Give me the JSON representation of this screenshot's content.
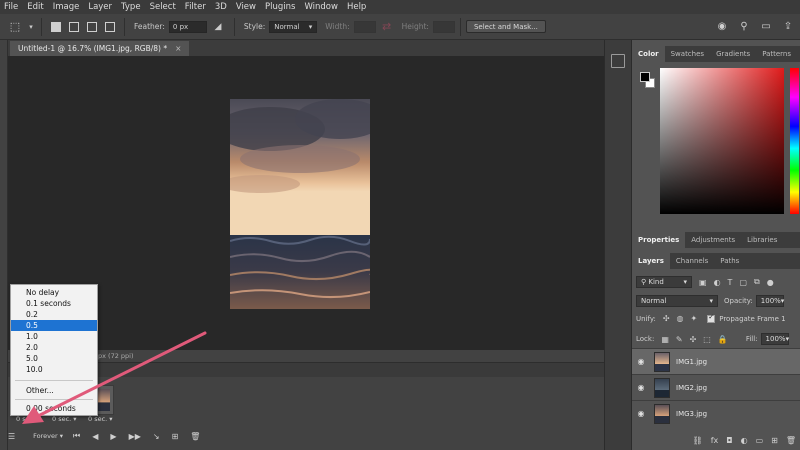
{
  "menu": [
    "File",
    "Edit",
    "Image",
    "Layer",
    "Type",
    "Select",
    "Filter",
    "3D",
    "View",
    "Plugins",
    "Window",
    "Help"
  ],
  "options": {
    "feather_label": "Feather:",
    "feather_value": "0 px",
    "style_label": "Style:",
    "style_value": "Normal",
    "width_label": "Width:",
    "height_label": "Height:",
    "select_mask": "Select and Mask..."
  },
  "document": {
    "tab_title": "Untitled-1 @ 16.7% (IMG1.jpg, RGB/8) *",
    "close": "×",
    "status": "px (72 ppi)"
  },
  "delay_menu": {
    "items": [
      "No delay",
      "0.1 seconds",
      "0.2",
      "0.5",
      "1.0",
      "2.0",
      "5.0",
      "10.0"
    ],
    "selected": "0.5",
    "other": "Other...",
    "current": "0.00 seconds"
  },
  "timeline": {
    "frames": [
      {
        "delay": "0 sec."
      },
      {
        "delay": "0 sec."
      },
      {
        "delay": "0 sec."
      }
    ],
    "loop": "Forever"
  },
  "color_panel": {
    "tabs": [
      "Color",
      "Swatches",
      "Gradients",
      "Patterns"
    ],
    "active_tab": "Color"
  },
  "properties_panel": {
    "tabs": [
      "Properties",
      "Adjustments",
      "Libraries"
    ]
  },
  "layers_panel": {
    "tabs": [
      "Layers",
      "Channels",
      "Paths"
    ],
    "filter": "Kind",
    "blend_mode": "Normal",
    "opacity_label": "Opacity:",
    "opacity_value": "100%",
    "unify_label": "Unify:",
    "propagate_label": "Propagate Frame 1",
    "lock_label": "Lock:",
    "fill_label": "Fill:",
    "fill_value": "100%",
    "layers": [
      {
        "name": "IMG1.jpg",
        "selected": true
      },
      {
        "name": "IMG2.jpg",
        "selected": false
      },
      {
        "name": "IMG3.jpg",
        "selected": false
      }
    ]
  },
  "colors": {
    "accent_blue": "#1e73d2",
    "arrow_pink": "#e05a7a"
  }
}
